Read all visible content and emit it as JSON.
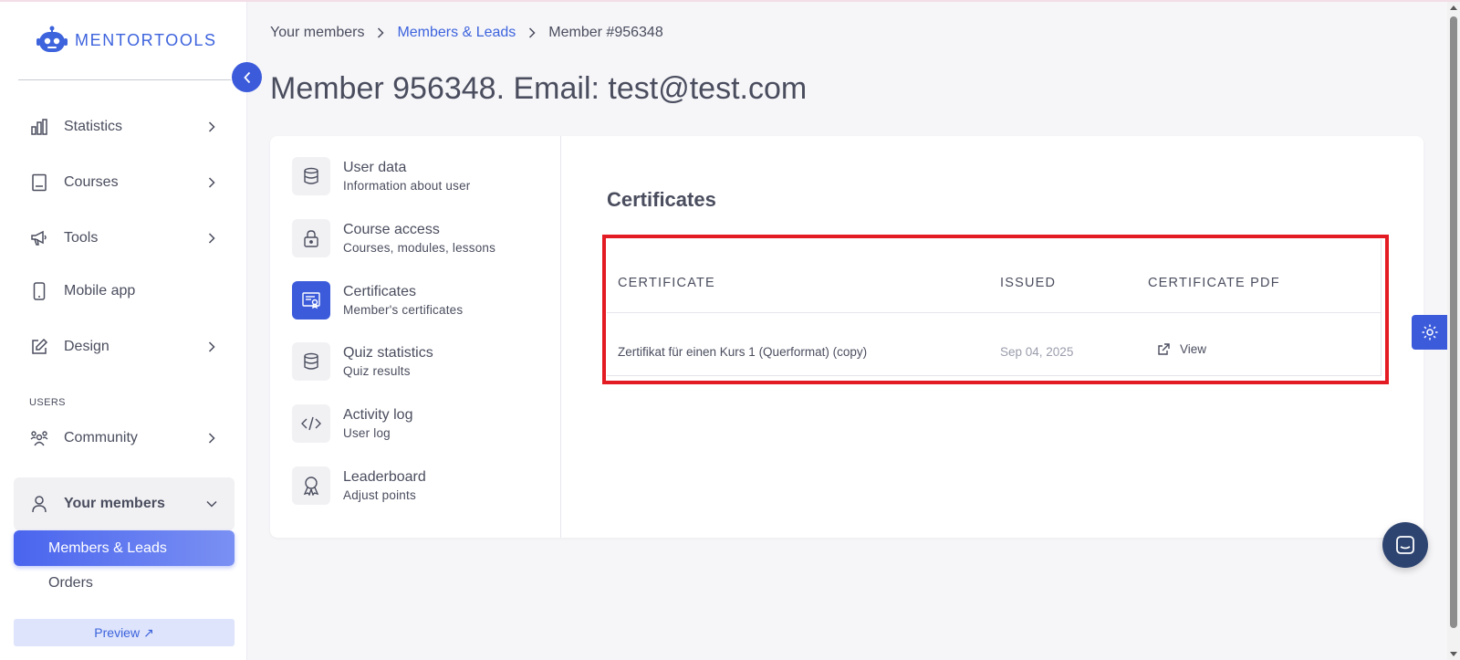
{
  "brand": {
    "name": "MENTORTOOLS"
  },
  "sidebar": {
    "items": [
      {
        "label": "Statistics",
        "icon": "bar-chart-icon"
      },
      {
        "label": "Courses",
        "icon": "book-icon"
      },
      {
        "label": "Tools",
        "icon": "megaphone-icon"
      },
      {
        "label": "Mobile app",
        "icon": "mobile-icon"
      },
      {
        "label": "Design",
        "icon": "edit-icon"
      }
    ],
    "section_users": "USERS",
    "community": {
      "label": "Community",
      "icon": "people-icon"
    },
    "your_members": {
      "label": "Your members",
      "icon": "user-icon"
    },
    "sub_items": {
      "members_leads": "Members & Leads",
      "orders": "Orders"
    },
    "preview": "Preview ↗"
  },
  "breadcrumb": {
    "first": "Your members",
    "second": "Members & Leads",
    "current": "Member #956348"
  },
  "page_title": "Member 956348. Email: test@test.com",
  "member_menu": [
    {
      "title": "User data",
      "subtitle": "Information about user",
      "icon": "database-icon"
    },
    {
      "title": "Course access",
      "subtitle": "Courses, modules, lessons",
      "icon": "lock-icon"
    },
    {
      "title": "Certificates",
      "subtitle": "Member's certificates",
      "icon": "certificate-icon",
      "active": true
    },
    {
      "title": "Quiz statistics",
      "subtitle": "Quiz results",
      "icon": "database-icon"
    },
    {
      "title": "Activity log",
      "subtitle": "User log",
      "icon": "code-icon"
    },
    {
      "title": "Leaderboard",
      "subtitle": "Adjust points",
      "icon": "award-icon"
    }
  ],
  "certificates": {
    "heading": "Certificates",
    "columns": {
      "certificate": "CERTIFICATE",
      "issued": "ISSUED",
      "pdf": "CERTIFICATE PDF"
    },
    "rows": [
      {
        "name": "Zertifikat für einen Kurs 1 (Querformat) (copy)",
        "issued": "Sep 04, 2025",
        "pdf_label": "View"
      }
    ]
  },
  "colors": {
    "accent": "#3b5bdb",
    "highlight": "#e31b23",
    "chat": "#2e4470"
  }
}
